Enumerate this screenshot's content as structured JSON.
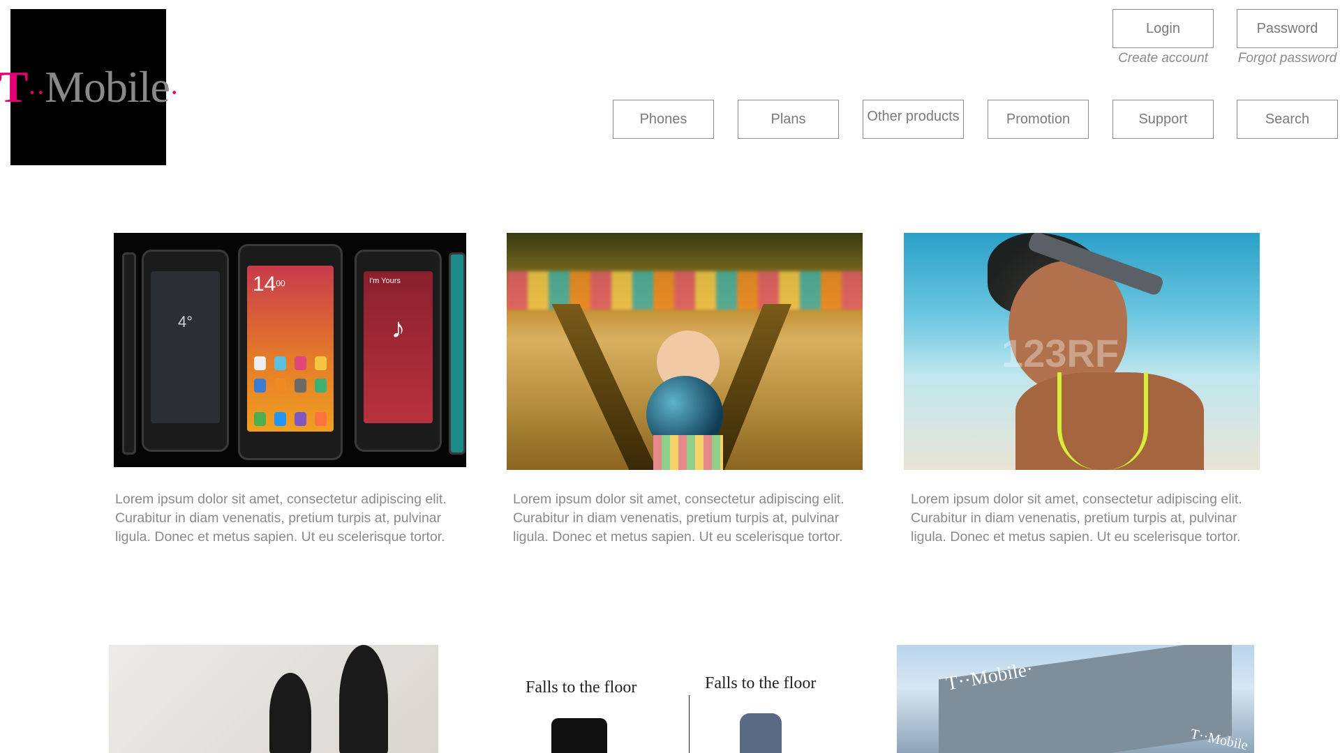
{
  "logo": {
    "text_t": "T",
    "text_dots": "··",
    "text_mobile": "Mobile",
    "text_dot_end": "·"
  },
  "auth": {
    "login_label": "Login",
    "password_label": "Password",
    "create_account": "Create account",
    "forgot_password": "Forgot password"
  },
  "nav": {
    "items": [
      {
        "label": "Phones"
      },
      {
        "label": "Plans"
      },
      {
        "label": "Other products"
      },
      {
        "label": "Promotion"
      },
      {
        "label": "Support"
      },
      {
        "label": "Search"
      }
    ]
  },
  "cards": [
    {
      "text": "Lorem ipsum dolor sit amet, consectetur adipiscing elit. Curabitur in diam venenatis, pretium turpis at, pulvinar ligula. Donec et metus sapien. Ut eu scelerisque tortor."
    },
    {
      "text": "Lorem ipsum dolor sit amet, consectetur adipiscing elit. Curabitur in diam venenatis, pretium turpis at, pulvinar ligula. Donec et metus sapien. Ut eu scelerisque tortor."
    },
    {
      "text": "Lorem ipsum dolor sit amet, consectetur adipiscing elit. Curabitur in diam venenatis, pretium turpis at, pulvinar ligula. Donec et metus sapien. Ut eu scelerisque tortor."
    }
  ],
  "images": {
    "phones": {
      "time": "14",
      "time_minutes": "00",
      "weather": "4°",
      "song": "I'm Yours"
    },
    "runner": {
      "watermark": "123RF"
    },
    "falls": {
      "caption_left": "Falls to the floor",
      "caption_right": "Falls to the floor"
    },
    "building": {
      "sign": "T··Mobile·",
      "sign2": "T··Mobile"
    }
  }
}
